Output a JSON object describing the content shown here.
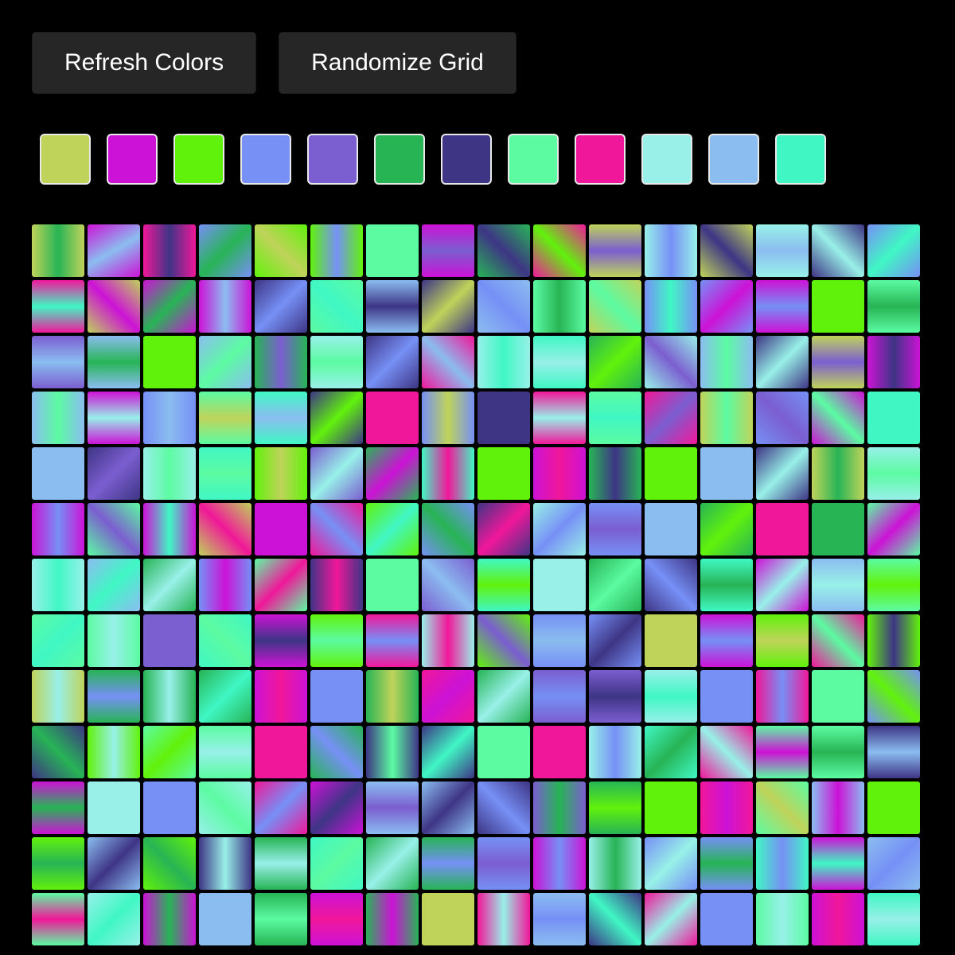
{
  "toolbar": {
    "refresh_label": "Refresh Colors",
    "randomize_label": "Randomize Grid"
  },
  "palette": [
    "#BFD35A",
    "#CC12D6",
    "#61F20C",
    "#7690F5",
    "#7B5ED0",
    "#27B455",
    "#3E3585",
    "#5CFBA2",
    "#F1179A",
    "#98F0E8",
    "#8BBDF0",
    "#40F7C4"
  ],
  "grid": {
    "columns": 16,
    "visible_rows": 13,
    "cells": [
      [
        0,
        5,
        90
      ],
      [
        1,
        10,
        150
      ],
      [
        8,
        6,
        90
      ],
      [
        3,
        5,
        135
      ],
      [
        2,
        0,
        45
      ],
      [
        2,
        3,
        90
      ],
      [
        7,
        7,
        0
      ],
      [
        1,
        4,
        0
      ],
      [
        5,
        6,
        45
      ],
      [
        8,
        2,
        45
      ],
      [
        0,
        4,
        0
      ],
      [
        9,
        3,
        90
      ],
      [
        0,
        6,
        45
      ],
      [
        9,
        10,
        0
      ],
      [
        6,
        9,
        45
      ],
      [
        3,
        11,
        135
      ],
      [
        8,
        11,
        0
      ],
      [
        0,
        1,
        45
      ],
      [
        1,
        5,
        135
      ],
      [
        1,
        10,
        90
      ],
      [
        6,
        3,
        135
      ],
      [
        7,
        11,
        45
      ],
      [
        10,
        6,
        0
      ],
      [
        6,
        0,
        135
      ],
      [
        10,
        3,
        45
      ],
      [
        7,
        5,
        90
      ],
      [
        0,
        7,
        45
      ],
      [
        3,
        11,
        90
      ],
      [
        3,
        1,
        135
      ],
      [
        1,
        3,
        0
      ],
      [
        2,
        2,
        0
      ],
      [
        7,
        5,
        0
      ],
      [
        4,
        10,
        0
      ],
      [
        10,
        5,
        0
      ],
      [
        2,
        2,
        0
      ],
      [
        10,
        7,
        135
      ],
      [
        5,
        4,
        90
      ],
      [
        9,
        7,
        0
      ],
      [
        6,
        3,
        135
      ],
      [
        8,
        10,
        45
      ],
      [
        9,
        11,
        90
      ],
      [
        11,
        9,
        0
      ],
      [
        5,
        2,
        135
      ],
      [
        9,
        4,
        45
      ],
      [
        10,
        7,
        90
      ],
      [
        6,
        9,
        135
      ],
      [
        0,
        4,
        0
      ],
      [
        1,
        6,
        90
      ],
      [
        10,
        7,
        90
      ],
      [
        1,
        9,
        0
      ],
      [
        3,
        10,
        90
      ],
      [
        7,
        0,
        0
      ],
      [
        11,
        10,
        0
      ],
      [
        6,
        2,
        135
      ],
      [
        8,
        8,
        0
      ],
      [
        3,
        0,
        90
      ],
      [
        6,
        6,
        0
      ],
      [
        8,
        9,
        0
      ],
      [
        7,
        11,
        0
      ],
      [
        8,
        4,
        135
      ],
      [
        0,
        7,
        90
      ],
      [
        3,
        4,
        45
      ],
      [
        1,
        7,
        45
      ],
      [
        11,
        11,
        0
      ],
      [
        10,
        10,
        0
      ],
      [
        6,
        4,
        135
      ],
      [
        9,
        7,
        90
      ],
      [
        11,
        7,
        0
      ],
      [
        2,
        0,
        90
      ],
      [
        4,
        9,
        135
      ],
      [
        5,
        1,
        135
      ],
      [
        11,
        8,
        90
      ],
      [
        2,
        2,
        0
      ],
      [
        1,
        8,
        90
      ],
      [
        5,
        6,
        90
      ],
      [
        2,
        2,
        0
      ],
      [
        10,
        10,
        90
      ],
      [
        6,
        9,
        135
      ],
      [
        0,
        5,
        90
      ],
      [
        9,
        7,
        0
      ],
      [
        1,
        3,
        90
      ],
      [
        7,
        4,
        45
      ],
      [
        1,
        11,
        90
      ],
      [
        0,
        8,
        45
      ],
      [
        1,
        1,
        0
      ],
      [
        8,
        3,
        45
      ],
      [
        2,
        11,
        135
      ],
      [
        3,
        5,
        45
      ],
      [
        6,
        8,
        135
      ],
      [
        9,
        3,
        135
      ],
      [
        3,
        4,
        0
      ],
      [
        10,
        10,
        0
      ],
      [
        5,
        2,
        135
      ],
      [
        8,
        8,
        0
      ],
      [
        5,
        5,
        0
      ],
      [
        7,
        1,
        135
      ],
      [
        9,
        11,
        90
      ],
      [
        10,
        11,
        135
      ],
      [
        5,
        9,
        135
      ],
      [
        3,
        1,
        90
      ],
      [
        7,
        8,
        135
      ],
      [
        6,
        8,
        90
      ],
      [
        7,
        7,
        0
      ],
      [
        4,
        10,
        45
      ],
      [
        11,
        2,
        0
      ],
      [
        9,
        9,
        0
      ],
      [
        5,
        7,
        135
      ],
      [
        6,
        3,
        45
      ],
      [
        11,
        5,
        0
      ],
      [
        1,
        9,
        135
      ],
      [
        10,
        9,
        0
      ],
      [
        7,
        2,
        0
      ],
      [
        7,
        11,
        135
      ],
      [
        7,
        9,
        90
      ],
      [
        4,
        4,
        0
      ],
      [
        11,
        7,
        45
      ],
      [
        1,
        6,
        0
      ],
      [
        2,
        7,
        0
      ],
      [
        8,
        3,
        0
      ],
      [
        9,
        8,
        90
      ],
      [
        2,
        4,
        45
      ],
      [
        3,
        10,
        0
      ],
      [
        3,
        6,
        135
      ],
      [
        0,
        0,
        0
      ],
      [
        1,
        3,
        0
      ],
      [
        2,
        0,
        0
      ],
      [
        8,
        7,
        45
      ],
      [
        2,
        6,
        90
      ],
      [
        0,
        9,
        90
      ],
      [
        5,
        3,
        0
      ],
      [
        5,
        9,
        90
      ],
      [
        5,
        11,
        135
      ],
      [
        1,
        8,
        90
      ],
      [
        3,
        3,
        0
      ],
      [
        5,
        0,
        90
      ],
      [
        8,
        1,
        135
      ],
      [
        5,
        9,
        135
      ],
      [
        4,
        3,
        0
      ],
      [
        4,
        6,
        0
      ],
      [
        9,
        11,
        0
      ],
      [
        3,
        3,
        45
      ],
      [
        8,
        3,
        90
      ],
      [
        7,
        7,
        0
      ],
      [
        3,
        2,
        45
      ],
      [
        6,
        5,
        45
      ],
      [
        2,
        9,
        90
      ],
      [
        7,
        2,
        135
      ],
      [
        7,
        9,
        0
      ],
      [
        8,
        8,
        0
      ],
      [
        5,
        3,
        45
      ],
      [
        6,
        7,
        90
      ],
      [
        6,
        11,
        135
      ],
      [
        7,
        7,
        0
      ],
      [
        8,
        8,
        0
      ],
      [
        9,
        3,
        90
      ],
      [
        11,
        5,
        135
      ],
      [
        8,
        9,
        45
      ],
      [
        7,
        1,
        0
      ],
      [
        7,
        5,
        0
      ],
      [
        6,
        10,
        0
      ],
      [
        1,
        5,
        0
      ],
      [
        9,
        9,
        0
      ],
      [
        3,
        3,
        0
      ],
      [
        9,
        7,
        45
      ],
      [
        8,
        3,
        135
      ],
      [
        1,
        6,
        135
      ],
      [
        10,
        4,
        0
      ],
      [
        10,
        6,
        135
      ],
      [
        6,
        3,
        45
      ],
      [
        4,
        5,
        90
      ],
      [
        5,
        2,
        0
      ],
      [
        2,
        2,
        0
      ],
      [
        8,
        1,
        90
      ],
      [
        7,
        0,
        45
      ],
      [
        10,
        1,
        90
      ],
      [
        2,
        2,
        0
      ],
      [
        2,
        5,
        0
      ],
      [
        10,
        6,
        135
      ],
      [
        2,
        5,
        45
      ],
      [
        6,
        9,
        90
      ],
      [
        5,
        9,
        0
      ],
      [
        11,
        7,
        135
      ],
      [
        5,
        9,
        135
      ],
      [
        5,
        3,
        0
      ],
      [
        3,
        4,
        0
      ],
      [
        1,
        3,
        90
      ],
      [
        9,
        5,
        90
      ],
      [
        3,
        9,
        135
      ],
      [
        3,
        5,
        0
      ],
      [
        11,
        3,
        90
      ],
      [
        1,
        11,
        0
      ],
      [
        10,
        3,
        135
      ],
      [
        7,
        8,
        0
      ],
      [
        9,
        11,
        135
      ],
      [
        1,
        5,
        90
      ],
      [
        10,
        10,
        0
      ],
      [
        5,
        7,
        0
      ],
      [
        1,
        8,
        0
      ],
      [
        5,
        1,
        90
      ],
      [
        0,
        0,
        0
      ],
      [
        8,
        9,
        90
      ],
      [
        10,
        3,
        0
      ],
      [
        6,
        11,
        45
      ],
      [
        8,
        9,
        135
      ],
      [
        3,
        3,
        0
      ],
      [
        7,
        9,
        90
      ],
      [
        1,
        8,
        90
      ],
      [
        11,
        9,
        0
      ]
    ]
  }
}
